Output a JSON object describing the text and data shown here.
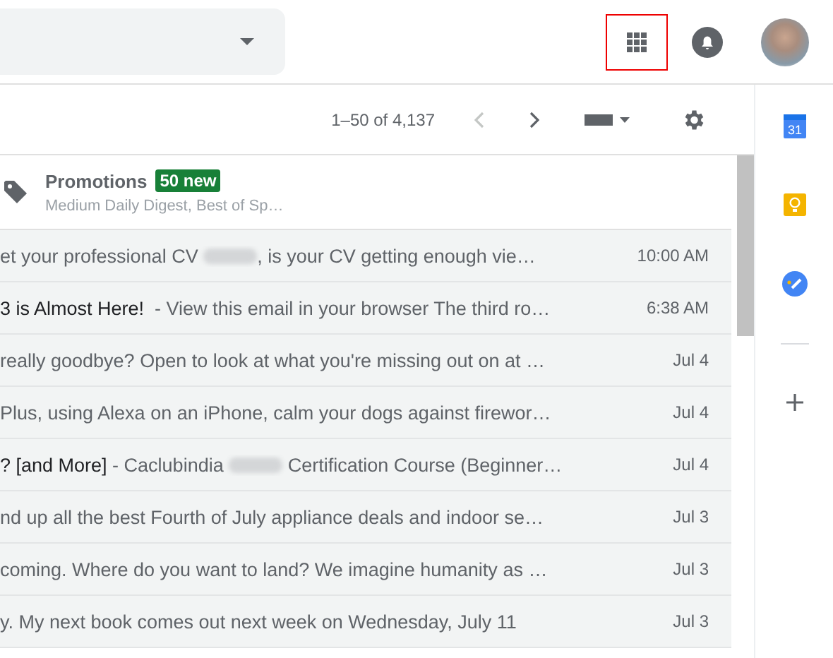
{
  "pager": {
    "range": "1–50 of 4,137"
  },
  "promotions": {
    "label": "Promotions",
    "badge": "50 new",
    "senders": "Medium Daily Digest, Best of Sp…"
  },
  "rows": [
    {
      "parts": [
        {
          "kind": "snippet",
          "text": "et your professional CV "
        },
        {
          "kind": "blur"
        },
        {
          "kind": "snippet",
          "text": ", is your CV getting enough vie…"
        }
      ],
      "date": "10:00 AM"
    },
    {
      "parts": [
        {
          "kind": "subject",
          "text": "3 is Almost Here! "
        },
        {
          "kind": "snippet",
          "text": " - View this email in your browser The third ro…"
        }
      ],
      "date": "6:38 AM"
    },
    {
      "parts": [
        {
          "kind": "snippet",
          "text": "really goodbye? Open to look at what you're missing out on at …"
        }
      ],
      "date": "Jul 4"
    },
    {
      "parts": [
        {
          "kind": "snippet",
          "text": "Plus, using Alexa on an iPhone, calm your dogs against firewor…"
        }
      ],
      "date": "Jul 4"
    },
    {
      "parts": [
        {
          "kind": "subject",
          "text": "? [and More]"
        },
        {
          "kind": "snippet",
          "text": " - Caclubindia "
        },
        {
          "kind": "blur"
        },
        {
          "kind": "snippet",
          "text": " Certification Course (Beginner…"
        }
      ],
      "date": "Jul 4"
    },
    {
      "parts": [
        {
          "kind": "snippet",
          "text": "nd up all the best Fourth of July appliance deals and indoor se…"
        }
      ],
      "date": "Jul 3"
    },
    {
      "parts": [
        {
          "kind": "snippet",
          "text": "coming. Where do you want to land? We imagine humanity as …"
        }
      ],
      "date": "Jul 3"
    },
    {
      "parts": [
        {
          "kind": "snippet",
          "text": "y. My next book comes out next week on Wednesday, July 11"
        }
      ],
      "date": "Jul 3"
    }
  ],
  "side_panel": {
    "calendar_day": "31"
  }
}
